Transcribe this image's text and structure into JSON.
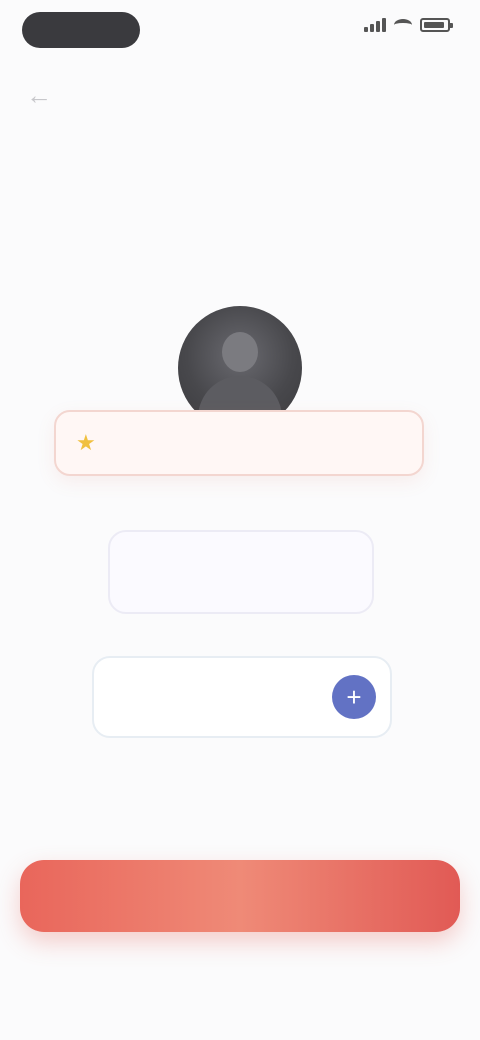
{
  "status_bar": {
    "time": ""
  },
  "hero": {
    "eyebrow": "",
    "headline": ""
  },
  "winner_banner": {
    "text": ""
  },
  "offer": {
    "primary": "",
    "secondary": ""
  },
  "stepper": {
    "value": "",
    "plus_symbol": "+"
  },
  "note": "",
  "cta": {
    "label": ""
  },
  "footer": {
    "text": "",
    "link": ""
  },
  "colors": {
    "accent": "#e9665b",
    "stepper_button": "#6272c4",
    "offer_text": "#c25a78",
    "avatar": "#48484c"
  },
  "icons": {
    "back": "back-arrow-icon",
    "star": "star-icon",
    "plus": "plus-icon"
  }
}
